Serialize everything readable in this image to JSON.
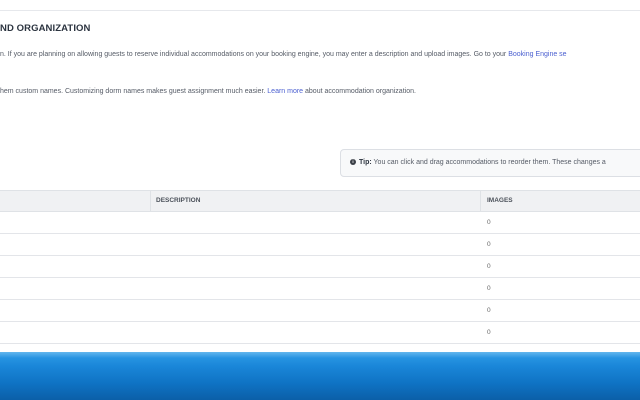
{
  "section": {
    "title": "ND ORGANIZATION",
    "description_line1_prefix": "n. If you are planning on allowing guests to reserve individual accommodations on your booking engine, you may enter a description and upload images. Go to your ",
    "description_line1_link": "Booking Engine se",
    "description_line2_prefix": "hem custom names. Customizing dorm names makes guest assignment much easier. ",
    "description_line2_link": "Learn more",
    "description_line2_suffix": " about accommodation organization."
  },
  "tip": {
    "icon": "info-icon",
    "label": "Tip:",
    "text": " You can click and drag accommodations to reorder them. These changes a"
  },
  "table": {
    "columns": [
      "",
      "DESCRIPTION",
      "IMAGES"
    ],
    "rows": [
      {
        "description": "",
        "images": "0"
      },
      {
        "description": "",
        "images": "0"
      },
      {
        "description": "",
        "images": "0"
      },
      {
        "description": "",
        "images": "0"
      },
      {
        "description": "",
        "images": "0"
      },
      {
        "description": "",
        "images": "0"
      }
    ]
  },
  "colors": {
    "link": "#4a5fd0",
    "taskbar": "#1a86d8"
  }
}
